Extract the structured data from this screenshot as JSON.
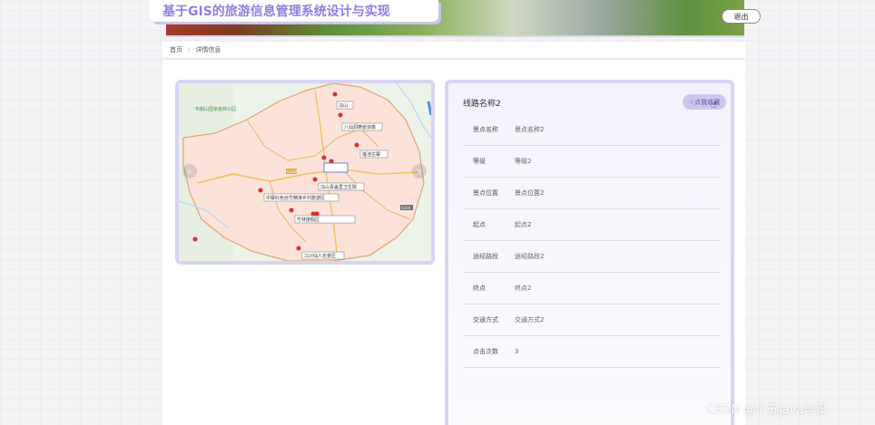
{
  "header": {
    "title": "基于GIS的旅游信息管理系统设计与实现",
    "logout_label": "退出"
  },
  "breadcrumb": {
    "home": "首页",
    "separator": "/",
    "current": "详情信息"
  },
  "map": {
    "labels": [
      "冯山",
      "八仙洞摩崖造像",
      "莲池古寨",
      "冯山青盖里卫生院",
      "中寨红色丝竹精准乡村旅游区",
      "竹林度假区",
      "江兴仙人岩景区"
    ],
    "road_labels": [
      "G348",
      "S204"
    ],
    "park_label": "布朗山国家森林公园",
    "prev_arrow": "‹",
    "next_arrow": "›"
  },
  "detail": {
    "route_name": "线路名称2",
    "favorite_label": "☆点我收藏",
    "fields": [
      {
        "label": "景点名称",
        "value": "景点名称2"
      },
      {
        "label": "等级",
        "value": "等级2"
      },
      {
        "label": "景点位置",
        "value": "景点位置2"
      },
      {
        "label": "起点",
        "value": "起点2"
      },
      {
        "label": "途经路段",
        "value": "途经路段2"
      },
      {
        "label": "终点",
        "value": "终点2"
      },
      {
        "label": "交通方式",
        "value": "交通方式2"
      },
      {
        "label": "点击次数",
        "value": "3"
      }
    ]
  },
  "watermark": "CSDN @小五java毕设"
}
